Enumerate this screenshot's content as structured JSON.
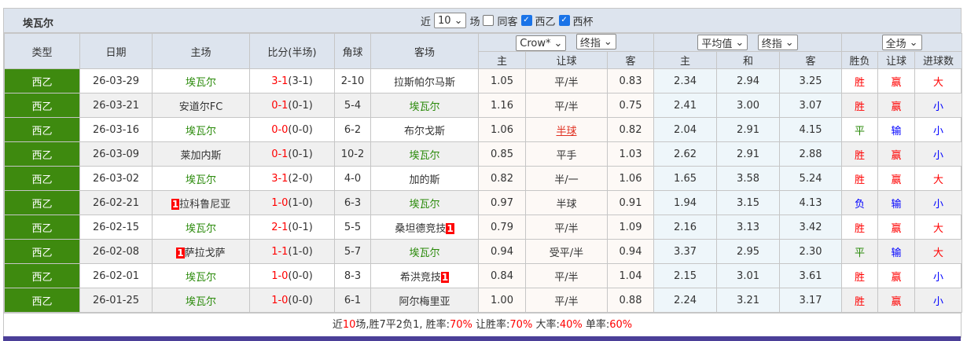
{
  "team": "埃瓦尔",
  "filters": {
    "prefix": "近",
    "count": "10",
    "suffix": "场",
    "same_away": "同客",
    "same_away_checked": false,
    "league1": "西乙",
    "league1_checked": true,
    "league2": "西杯",
    "league2_checked": true
  },
  "headers": {
    "type": "类型",
    "date": "日期",
    "home": "主场",
    "score": "比分(半场)",
    "corner": "角球",
    "away": "客场",
    "sel_company": "Crow*",
    "sel_ah": "终指",
    "sel_avg": "平均值",
    "sel_eu": "终指",
    "sel_scope": "全场",
    "ah_home": "主",
    "ah_line": "让球",
    "ah_away": "客",
    "eu_home": "主",
    "eu_draw": "和",
    "eu_away": "客",
    "res": "胜负",
    "res_ah": "让球",
    "res_goals": "进球数"
  },
  "colors": {
    "team_highlight": "#2a8a0a",
    "type_bg": "#3e8a0f",
    "win": "#ff0000",
    "lose": "#0000ff",
    "draw": "#2a8a0a"
  },
  "rows": [
    {
      "type": "西乙",
      "date": "26-03-29",
      "home": "埃瓦尔",
      "home_rc": "",
      "score": "3-1",
      "ht": "(3-1)",
      "corner": "2-10",
      "away": "拉斯帕尔马斯",
      "away_rc": "",
      "ah_h": "1.05",
      "ah": "平/半",
      "ah_a": "0.83",
      "eu_h": "2.34",
      "eu_d": "2.94",
      "eu_a": "3.25",
      "res": "胜",
      "res_ah": "赢",
      "goals": "大"
    },
    {
      "type": "西乙",
      "date": "26-03-21",
      "home": "安道尔FC",
      "home_rc": "",
      "score": "0-1",
      "ht": "(0-1)",
      "corner": "5-4",
      "away": "埃瓦尔",
      "away_rc": "",
      "ah_h": "1.16",
      "ah": "平/半",
      "ah_a": "0.75",
      "eu_h": "2.41",
      "eu_d": "3.00",
      "eu_a": "3.07",
      "res": "胜",
      "res_ah": "赢",
      "goals": "小"
    },
    {
      "type": "西乙",
      "date": "26-03-16",
      "home": "埃瓦尔",
      "home_rc": "",
      "score": "0-0",
      "ht": "(0-0)",
      "corner": "6-2",
      "away": "布尔戈斯",
      "away_rc": "",
      "ah_h": "1.06",
      "ah": "半球",
      "ah_a": "0.82",
      "eu_h": "2.04",
      "eu_d": "2.91",
      "eu_a": "4.15",
      "res": "平",
      "res_ah": "输",
      "goals": "小",
      "ah_link": true
    },
    {
      "type": "西乙",
      "date": "26-03-09",
      "home": "莱加内斯",
      "home_rc": "",
      "score": "0-1",
      "ht": "(0-1)",
      "corner": "10-2",
      "away": "埃瓦尔",
      "away_rc": "",
      "ah_h": "0.85",
      "ah": "平手",
      "ah_a": "1.03",
      "eu_h": "2.62",
      "eu_d": "2.91",
      "eu_a": "2.88",
      "res": "胜",
      "res_ah": "赢",
      "goals": "小"
    },
    {
      "type": "西乙",
      "date": "26-03-02",
      "home": "埃瓦尔",
      "home_rc": "",
      "score": "3-1",
      "ht": "(2-0)",
      "corner": "4-0",
      "away": "加的斯",
      "away_rc": "",
      "ah_h": "0.82",
      "ah": "半/一",
      "ah_a": "1.06",
      "eu_h": "1.65",
      "eu_d": "3.58",
      "eu_a": "5.24",
      "res": "胜",
      "res_ah": "赢",
      "goals": "大"
    },
    {
      "type": "西乙",
      "date": "26-02-21",
      "home": "拉科鲁尼亚",
      "home_rc": "1",
      "score": "1-0",
      "ht": "(1-0)",
      "corner": "6-3",
      "away": "埃瓦尔",
      "away_rc": "",
      "ah_h": "0.97",
      "ah": "半球",
      "ah_a": "0.91",
      "eu_h": "1.94",
      "eu_d": "3.15",
      "eu_a": "4.13",
      "res": "负",
      "res_ah": "输",
      "goals": "小"
    },
    {
      "type": "西乙",
      "date": "26-02-15",
      "home": "埃瓦尔",
      "home_rc": "",
      "score": "2-1",
      "ht": "(0-1)",
      "corner": "5-5",
      "away": "桑坦德竞技",
      "away_rc": "1",
      "ah_h": "0.79",
      "ah": "平/半",
      "ah_a": "1.09",
      "eu_h": "2.16",
      "eu_d": "3.13",
      "eu_a": "3.42",
      "res": "胜",
      "res_ah": "赢",
      "goals": "大"
    },
    {
      "type": "西乙",
      "date": "26-02-08",
      "home": "萨拉戈萨",
      "home_rc": "1",
      "score": "1-1",
      "ht": "(1-0)",
      "corner": "5-7",
      "away": "埃瓦尔",
      "away_rc": "",
      "ah_h": "0.94",
      "ah": "受平/半",
      "ah_a": "0.94",
      "eu_h": "3.37",
      "eu_d": "2.95",
      "eu_a": "2.30",
      "res": "平",
      "res_ah": "输",
      "goals": "大"
    },
    {
      "type": "西乙",
      "date": "26-02-01",
      "home": "埃瓦尔",
      "home_rc": "",
      "score": "1-0",
      "ht": "(0-0)",
      "corner": "8-3",
      "away": "希洪竞技",
      "away_rc": "1",
      "ah_h": "0.84",
      "ah": "平/半",
      "ah_a": "1.04",
      "eu_h": "2.15",
      "eu_d": "3.01",
      "eu_a": "3.61",
      "res": "胜",
      "res_ah": "赢",
      "goals": "小"
    },
    {
      "type": "西乙",
      "date": "26-01-25",
      "home": "埃瓦尔",
      "home_rc": "",
      "score": "1-0",
      "ht": "(0-0)",
      "corner": "6-1",
      "away": "阿尔梅里亚",
      "away_rc": "",
      "ah_h": "1.00",
      "ah": "平/半",
      "ah_a": "0.88",
      "eu_h": "2.24",
      "eu_d": "3.21",
      "eu_a": "3.17",
      "res": "胜",
      "res_ah": "赢",
      "goals": "小"
    }
  ],
  "summary": {
    "p1": "近",
    "n": "10",
    "p2": "场,胜7平2负1, 胜率:",
    "win_rate": "70%",
    "p3": " 让胜率:",
    "ah_rate": "70%",
    "p4": " 大率:",
    "over_rate": "40%",
    "p5": " 单率:",
    "odd_rate": "60%"
  }
}
